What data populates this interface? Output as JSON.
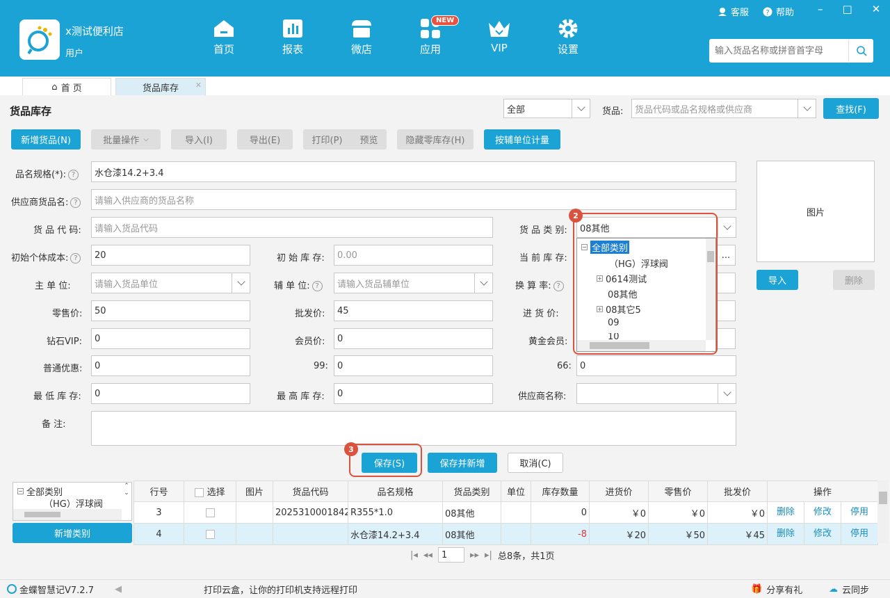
{
  "app": {
    "store_name": "x测试便利店",
    "user": "用户"
  },
  "nav": [
    {
      "label": "首页",
      "icon": "home-icon"
    },
    {
      "label": "报表",
      "icon": "report-icon"
    },
    {
      "label": "微店",
      "icon": "store-icon"
    },
    {
      "label": "应用",
      "icon": "apps-icon",
      "badge": "NEW"
    },
    {
      "label": "VIP",
      "icon": "vip-crown-icon"
    },
    {
      "label": "设置",
      "icon": "gear-icon"
    }
  ],
  "top_links": {
    "service": "客服",
    "help": "帮助"
  },
  "top_search": {
    "placeholder": "输入货品名称或拼音首字母"
  },
  "tabs": {
    "home": "首 页",
    "stock": "货品库存"
  },
  "page": {
    "title": "货品库存"
  },
  "filter": {
    "category_value": "全部",
    "goods_label": "货品:",
    "goods_placeholder": "货品代码或品名规格或供应商",
    "search_button": "查找(F)"
  },
  "toolbar": {
    "add": "新增货品(N)",
    "batch": "批量操作",
    "import": "导入(I)",
    "export": "导出(E)",
    "print": "打印(P)",
    "preview": "预览",
    "hide_zero": "隐藏零库存(H)",
    "aux_unit": "按辅单位计量"
  },
  "form": {
    "name_label": "品名规格(*):",
    "name_value": "水仓漆14.2+3.4",
    "supplier_name_label": "供应商货品名:",
    "supplier_name_placeholder": "请输入供应商的货品名称",
    "code_label": "货 品 代 码:",
    "code_placeholder": "请输入货品代码",
    "category_label": "货 品 类 别:",
    "category_value": "08其他",
    "init_cost_label": "初始个体成本:",
    "init_cost_value": "20",
    "init_stock_label": "初 始 库 存:",
    "init_stock_value": "0.00",
    "current_stock_label": "当 前 库 存:",
    "main_unit_label": "主   单   位:",
    "main_unit_placeholder": "请输入货品单位",
    "aux_unit_label": "辅 单 位:",
    "aux_unit_placeholder": "请输入货品辅单位",
    "ratio_label": "换 算 率:",
    "retail_label": "零售价:",
    "retail_value": "50",
    "wholesale_label": "批发价:",
    "wholesale_value": "45",
    "purchase_label": "进   货   价:",
    "diamond_label": "钻石VIP:",
    "diamond_value": "0",
    "member_label": "会员价:",
    "member_value": "0",
    "gold_label": "黄金会员:",
    "normal_label": "普通优惠:",
    "normal_value": "0",
    "p99_label": "99:",
    "p99_value": "0",
    "p66_label": "66:",
    "p66_value": "0",
    "min_stock_label": "最 低 库 存:",
    "min_stock_value": "0",
    "max_stock_label": "最 高 库 存:",
    "max_stock_value": "0",
    "supplier_label": "供应商名称:",
    "remark_label": "备      注:"
  },
  "photo": {
    "label": "图片",
    "import": "导入",
    "delete": "删除"
  },
  "tree": {
    "items": [
      {
        "label": "全部类别",
        "expand": "⊟"
      },
      {
        "label": "（HG）浮球阀",
        "expand": ""
      },
      {
        "label": "0614测试",
        "expand": "+"
      },
      {
        "label": "08其他",
        "expand": ""
      },
      {
        "label": "08其它5",
        "expand": "+"
      },
      {
        "label": "09",
        "expand": ""
      },
      {
        "label": "10",
        "expand": ""
      }
    ]
  },
  "badges": {
    "two": "2",
    "three": "3"
  },
  "actions": {
    "save": "保存(S)",
    "save_new": "保存并新增",
    "cancel": "取消(C)"
  },
  "left_tree": {
    "root": "全部类别",
    "child": "（HG）浮球阀",
    "add_category": "新增类别"
  },
  "table": {
    "headers": [
      "行号",
      "选择",
      "图片",
      "货品代码",
      "品名规格",
      "货品类别",
      "单位",
      "库存数量",
      "进货价",
      "零售价",
      "批发价",
      "操作"
    ],
    "rows": [
      {
        "no": "3",
        "code": "2025310001842",
        "name": "R355*1.0",
        "category": "08其他",
        "unit": "",
        "qty": "0",
        "purchase": "￥0",
        "retail": "￥0",
        "wholesale": "￥0"
      },
      {
        "no": "4",
        "code": "",
        "name": "水仓漆14.2+3.4",
        "category": "08其他",
        "unit": "",
        "qty": "-8",
        "purchase": "￥20",
        "retail": "￥50",
        "wholesale": "￥45"
      }
    ],
    "ops": [
      "删除",
      "修改",
      "停用"
    ]
  },
  "pager": {
    "page": "1",
    "summary": "总8条，共1页"
  },
  "status": {
    "version": "金蝶智慧记V7.2.7",
    "message": "打印云盒，让你的打印机支持远程打印",
    "share": "分享有礼",
    "sync": "云同步"
  },
  "colors": {
    "primary": "#1ba3d6",
    "highlight_red": "#d9533f",
    "negative": "#e0383a"
  }
}
